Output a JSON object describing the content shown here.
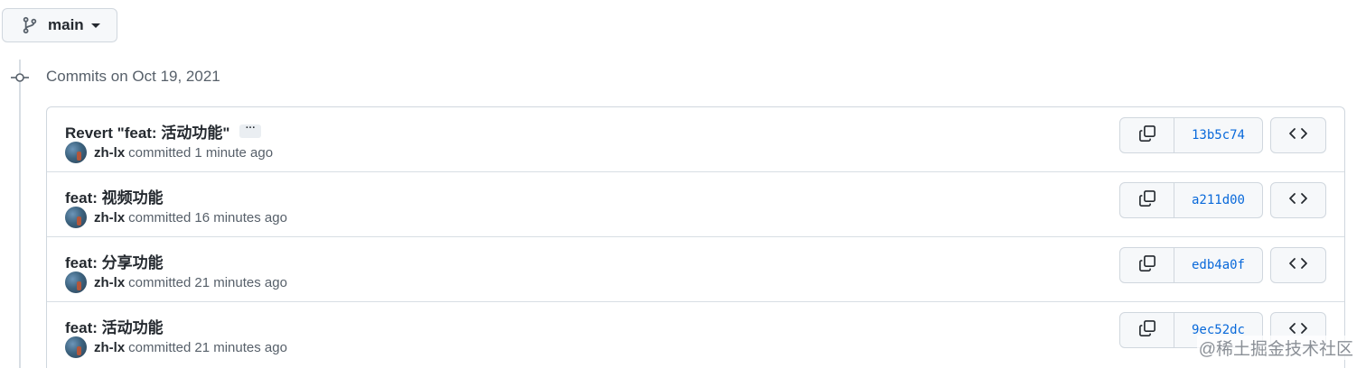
{
  "branch": {
    "name": "main"
  },
  "date_heading": "Commits on Oct 19, 2021",
  "commits": [
    {
      "title": "Revert \"feat: 活动功能\"",
      "has_ellipsis": true,
      "ellipsis": "···",
      "author": "zh-lx",
      "committed_label": "committed",
      "time": "1 minute ago",
      "sha": "13b5c74"
    },
    {
      "title": "feat: 视频功能",
      "has_ellipsis": false,
      "ellipsis": "",
      "author": "zh-lx",
      "committed_label": "committed",
      "time": "16 minutes ago",
      "sha": "a211d00"
    },
    {
      "title": "feat: 分享功能",
      "has_ellipsis": false,
      "ellipsis": "",
      "author": "zh-lx",
      "committed_label": "committed",
      "time": "21 minutes ago",
      "sha": "edb4a0f"
    },
    {
      "title": "feat: 活动功能",
      "has_ellipsis": false,
      "ellipsis": "",
      "author": "zh-lx",
      "committed_label": "committed",
      "time": "21 minutes ago",
      "sha": "9ec52dc"
    }
  ],
  "watermark": "@稀土掘金技术社区",
  "icons": {
    "branch": "git-branch-icon",
    "caret": "caret-down-icon",
    "timeline": "git-commit-icon",
    "copy": "copy-icon",
    "browse": "code-icon"
  },
  "colors": {
    "link": "#0969da",
    "border": "#d0d7de",
    "button_bg": "#f6f8fa",
    "muted": "#57606a"
  }
}
